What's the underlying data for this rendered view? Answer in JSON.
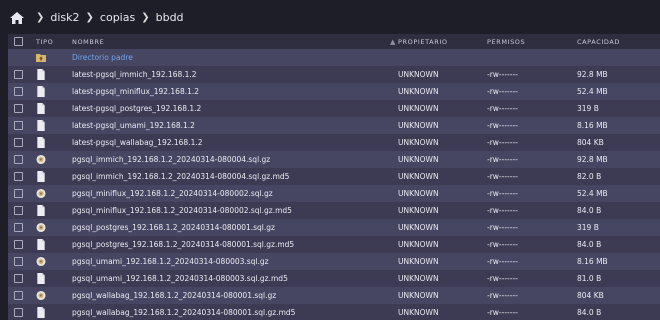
{
  "breadcrumb": [
    "disk2",
    "copias",
    "bbdd"
  ],
  "header": {
    "tipo": "TIPO",
    "nombre": "NOMBRE",
    "propietario": "PROPIETARIO",
    "permisos": "PERMISOS",
    "capacidad": "CAPACIDAD"
  },
  "parent_label": "Directorio padre",
  "files": [
    {
      "name": "latest-pgsql_immich_192.168.1.2",
      "owner": "UNKNOWN",
      "perm": "-rw-------",
      "size": "92.8 MB",
      "icon": "doc"
    },
    {
      "name": "latest-pgsql_miniflux_192.168.1.2",
      "owner": "UNKNOWN",
      "perm": "-rw-------",
      "size": "52.4 MB",
      "icon": "doc"
    },
    {
      "name": "latest-pgsql_postgres_192.168.1.2",
      "owner": "UNKNOWN",
      "perm": "-rw-------",
      "size": "319 B",
      "icon": "doc"
    },
    {
      "name": "latest-pgsql_umami_192.168.1.2",
      "owner": "UNKNOWN",
      "perm": "-rw-------",
      "size": "8.16 MB",
      "icon": "doc"
    },
    {
      "name": "latest-pgsql_wallabag_192.168.1.2",
      "owner": "UNKNOWN",
      "perm": "-rw-------",
      "size": "804 KB",
      "icon": "doc"
    },
    {
      "name": "pgsql_immich_192.168.1.2_20240314-080004.sql.gz",
      "owner": "UNKNOWN",
      "perm": "-rw-------",
      "size": "92.8 MB",
      "icon": "archive"
    },
    {
      "name": "pgsql_immich_192.168.1.2_20240314-080004.sql.gz.md5",
      "owner": "UNKNOWN",
      "perm": "-rw-------",
      "size": "82.0 B",
      "icon": "doc"
    },
    {
      "name": "pgsql_miniflux_192.168.1.2_20240314-080002.sql.gz",
      "owner": "UNKNOWN",
      "perm": "-rw-------",
      "size": "52.4 MB",
      "icon": "archive"
    },
    {
      "name": "pgsql_miniflux_192.168.1.2_20240314-080002.sql.gz.md5",
      "owner": "UNKNOWN",
      "perm": "-rw-------",
      "size": "84.0 B",
      "icon": "doc"
    },
    {
      "name": "pgsql_postgres_192.168.1.2_20240314-080001.sql.gz",
      "owner": "UNKNOWN",
      "perm": "-rw-------",
      "size": "319 B",
      "icon": "archive"
    },
    {
      "name": "pgsql_postgres_192.168.1.2_20240314-080001.sql.gz.md5",
      "owner": "UNKNOWN",
      "perm": "-rw-------",
      "size": "84.0 B",
      "icon": "doc"
    },
    {
      "name": "pgsql_umami_192.168.1.2_20240314-080003.sql.gz",
      "owner": "UNKNOWN",
      "perm": "-rw-------",
      "size": "8.16 MB",
      "icon": "archive"
    },
    {
      "name": "pgsql_umami_192.168.1.2_20240314-080003.sql.gz.md5",
      "owner": "UNKNOWN",
      "perm": "-rw-------",
      "size": "81.0 B",
      "icon": "doc"
    },
    {
      "name": "pgsql_wallabag_192.168.1.2_20240314-080001.sql.gz",
      "owner": "UNKNOWN",
      "perm": "-rw-------",
      "size": "804 KB",
      "icon": "archive"
    },
    {
      "name": "pgsql_wallabag_192.168.1.2_20240314-080001.sql.gz.md5",
      "owner": "UNKNOWN",
      "perm": "-rw-------",
      "size": "84.0 B",
      "icon": "doc"
    }
  ]
}
